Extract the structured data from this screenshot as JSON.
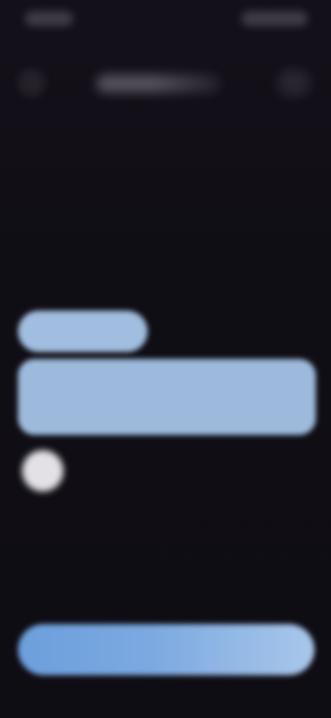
{
  "colors": {
    "background": "#100e15",
    "pill": "#a9c7ea",
    "card": "#a5c4e8",
    "avatar": "#e3e1e6",
    "button_start": "#6c9fdc",
    "button_end": "#a9c7ea"
  },
  "icons": {
    "back": "back-arrow-icon",
    "action": "more-icon"
  }
}
